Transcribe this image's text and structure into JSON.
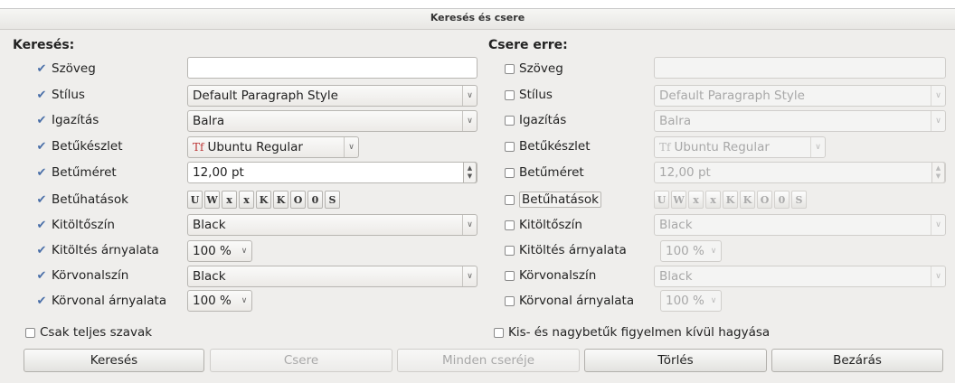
{
  "window": {
    "title": "Keresés és csere"
  },
  "background_text": "...",
  "search": {
    "heading": "Keresés:",
    "rows": [
      {
        "label": "Szöveg",
        "checked": true,
        "value": ""
      },
      {
        "label": "Stílus",
        "checked": true,
        "value": "Default Paragraph Style"
      },
      {
        "label": "Igazítás",
        "checked": true,
        "value": "Balra"
      },
      {
        "label": "Betűkészlet",
        "checked": true,
        "value": "Ubuntu Regular"
      },
      {
        "label": "Betűméret",
        "checked": true,
        "value": "12,00 pt"
      },
      {
        "label": "Betűhatások",
        "checked": true
      },
      {
        "label": "Kitöltőszín",
        "checked": true,
        "value": "Black"
      },
      {
        "label": "Kitöltés árnyalata",
        "checked": true,
        "value": "100 %"
      },
      {
        "label": "Körvonalszín",
        "checked": true,
        "value": "Black"
      },
      {
        "label": "Körvonal árnyalata",
        "checked": true,
        "value": "100 %"
      }
    ]
  },
  "replace": {
    "heading": "Csere erre:",
    "rows": [
      {
        "label": "Szöveg",
        "checked": false,
        "value": ""
      },
      {
        "label": "Stílus",
        "checked": false,
        "value": "Default Paragraph Style"
      },
      {
        "label": "Igazítás",
        "checked": false,
        "value": "Balra"
      },
      {
        "label": "Betűkészlet",
        "checked": false,
        "value": "Ubuntu Regular"
      },
      {
        "label": "Betűméret",
        "checked": false,
        "value": "12,00 pt"
      },
      {
        "label": "Betűhatások",
        "checked": false
      },
      {
        "label": "Kitöltőszín",
        "checked": false,
        "value": "Black"
      },
      {
        "label": "Kitöltés árnyalata",
        "checked": false,
        "value": "100 %"
      },
      {
        "label": "Körvonalszín",
        "checked": false,
        "value": "Black"
      },
      {
        "label": "Körvonal árnyalata",
        "checked": false,
        "value": "100 %"
      }
    ]
  },
  "effects": [
    "U",
    "W",
    "x",
    "x",
    "K",
    "K",
    "O",
    "0",
    "S"
  ],
  "font_icon": "Tf",
  "options": {
    "whole_words": {
      "label": "Csak teljes szavak",
      "checked": false
    },
    "ignore_case": {
      "label": "Kis- és nagybetűk figyelmen kívül hagyása",
      "checked": false
    }
  },
  "buttons": {
    "search": "Keresés",
    "replace": "Csere",
    "replace_all": "Minden cseréje",
    "delete": "Törlés",
    "close": "Bezárás"
  },
  "colors": {
    "accent": "#4a6fa8",
    "dialog_bg": "#efeeec",
    "disabled_text": "#a8a8a8"
  },
  "icons": {
    "checked": "checkmark-icon",
    "dropdown": "chevron-down-icon",
    "spin": "spinner-arrows-icon"
  }
}
